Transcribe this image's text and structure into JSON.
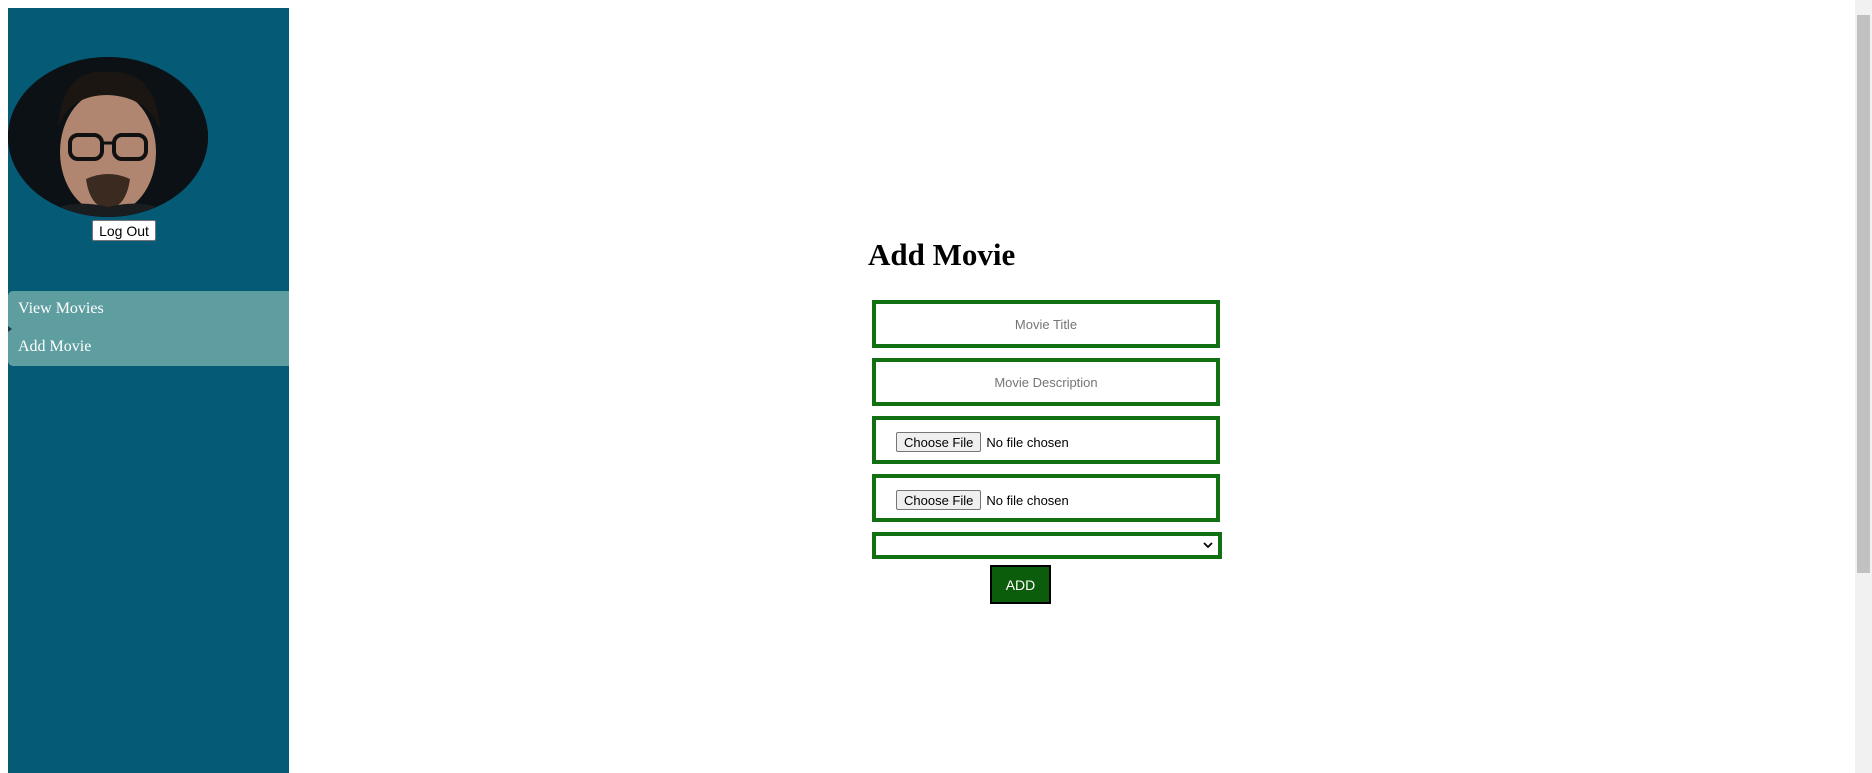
{
  "sidebar": {
    "avatar_alt": "user avatar",
    "logout_label": "Log Out",
    "nav_items": [
      {
        "label": "View Movies"
      },
      {
        "label": "Add Movie"
      }
    ]
  },
  "main": {
    "title": "Add Movie",
    "form": {
      "title_placeholder": "Movie Title",
      "title_value": "",
      "description_placeholder": "Movie Description",
      "description_value": "",
      "file_inputs": [
        {
          "button_label": "Choose File",
          "status": "No file chosen"
        },
        {
          "button_label": "Choose File",
          "status": "No file chosen"
        }
      ],
      "select_value": "",
      "submit_label": "ADD"
    }
  },
  "colors": {
    "sidebar_bg": "#055a75",
    "nav_bg": "#5f9ea0",
    "field_border": "#117011",
    "button_bg": "#0b5c0b"
  }
}
